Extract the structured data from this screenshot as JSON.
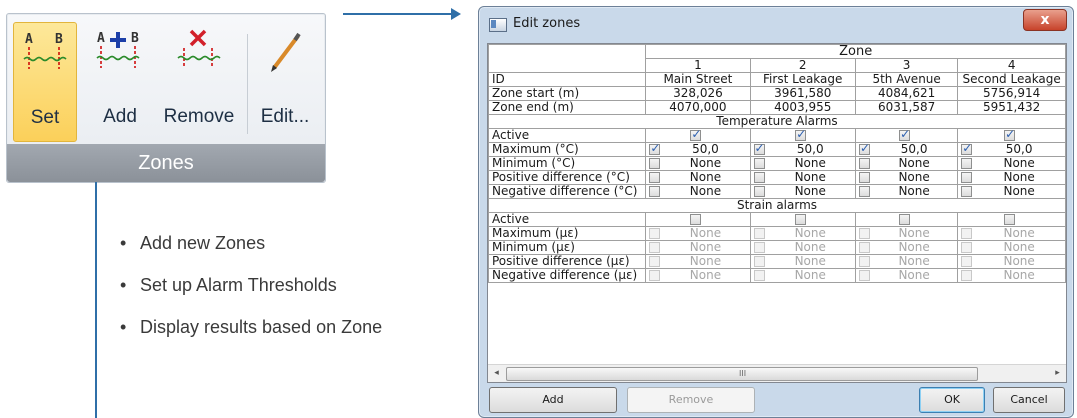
{
  "ribbon": {
    "group_label": "Zones",
    "buttons": [
      {
        "label": "Set",
        "icon": "zone-set-icon",
        "selected": true
      },
      {
        "label": "Add",
        "icon": "zone-add-icon"
      },
      {
        "label": "Remove",
        "icon": "zone-remove-icon"
      },
      {
        "label": "Edit...",
        "icon": "pencil-icon"
      }
    ],
    "icon_letters": {
      "a": "A",
      "b": "B"
    }
  },
  "bullets": [
    "Add new Zones",
    "Set up Alarm Thresholds",
    "Display results based on Zone"
  ],
  "dialog": {
    "title": "Edit zones",
    "close_glyph": "x",
    "zone_header": "Zone",
    "zone_numbers": [
      "1",
      "2",
      "3",
      "4"
    ],
    "rows": {
      "id_label": "ID",
      "ids": [
        "Main Street",
        "First Leakage",
        "5th Avenue",
        "Second Leakage"
      ],
      "start_label": "Zone start (m)",
      "starts": [
        "328,026",
        "3961,580",
        "4084,621",
        "5756,914"
      ],
      "end_label": "Zone end (m)",
      "ends": [
        "4070,000",
        "4003,955",
        "6031,587",
        "5951,432"
      ]
    },
    "temperature": {
      "title": "Temperature Alarms",
      "active_label": "Active",
      "active": [
        true,
        true,
        true,
        true
      ],
      "max_label": "Maximum (°C)",
      "max_checked": [
        true,
        true,
        true,
        true
      ],
      "max_values": [
        "50,0",
        "50,0",
        "50,0",
        "50,0"
      ],
      "min_label": "Minimum (°C)",
      "pos_label": "Positive difference (°C)",
      "neg_label": "Negative difference (°C)",
      "none": "None"
    },
    "strain": {
      "title": "Strain alarms",
      "active_label": "Active",
      "active": [
        false,
        false,
        false,
        false
      ],
      "max_label": "Maximum (με)",
      "min_label": "Minimum (με)",
      "pos_label": "Positive difference (με)",
      "neg_label": "Negative difference (με)",
      "none": "None"
    },
    "scrollbar": {
      "left": "◂",
      "right": "▸",
      "grip": "III"
    },
    "buttons": {
      "add": "Add",
      "remove": "Remove",
      "ok": "OK",
      "cancel": "Cancel"
    }
  },
  "colors": {
    "accent": "#2f6fa8",
    "selected_button": "#fbd05a",
    "dialog_frame": "#c9d9ea"
  }
}
